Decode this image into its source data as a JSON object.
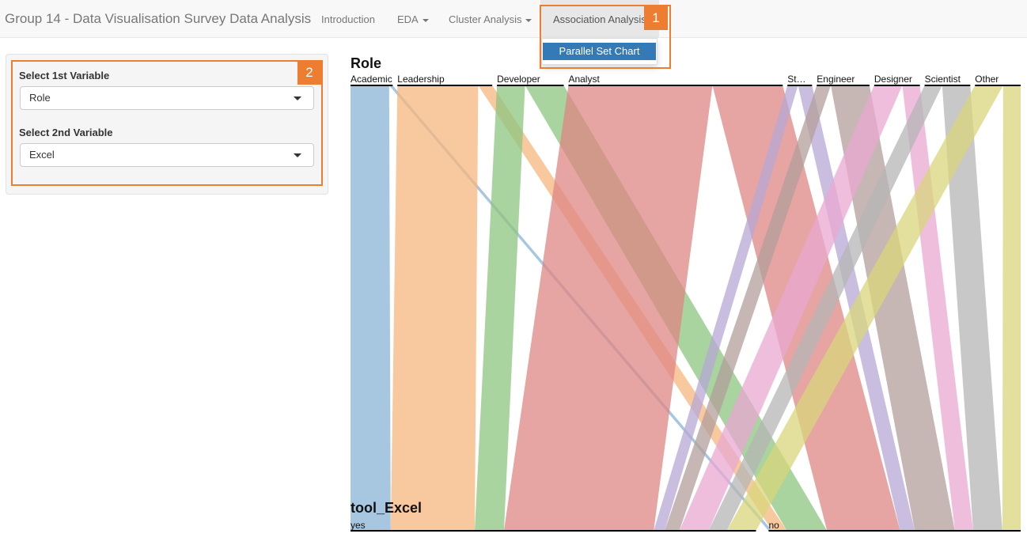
{
  "navbar": {
    "brand": "Group 14 - Data Visualisation Survey Data Analysis",
    "items": [
      {
        "label": "Introduction",
        "dropdown": false
      },
      {
        "label": "EDA",
        "dropdown": true
      },
      {
        "label": "Cluster Analysis",
        "dropdown": true
      },
      {
        "label": "Association Analysis",
        "dropdown": true,
        "active": true
      }
    ],
    "dropdown_menu": [
      {
        "label": "Parallel Set Chart",
        "selected": true
      }
    ]
  },
  "annotations": [
    {
      "number": "1",
      "color": "#ed7d31"
    },
    {
      "number": "2",
      "color": "#ed7d31"
    }
  ],
  "sidebar": {
    "var1": {
      "label": "Select 1st Variable",
      "value": "Role"
    },
    "var2": {
      "label": "Select 2nd Variable",
      "value": "Excel"
    }
  },
  "chart_data": {
    "type": "parallel-sets",
    "dimensions": [
      {
        "name": "Role",
        "categories": [
          "Academic",
          "Leadership",
          "Developer",
          "Analyst",
          "St…",
          "Engineer",
          "Designer",
          "Scientist",
          "Other"
        ]
      },
      {
        "name": "tool_Excel",
        "categories": [
          "yes",
          "no"
        ]
      }
    ],
    "role_counts": {
      "Academic": 12,
      "Leadership": 27,
      "Developer": 19,
      "Analyst": 61,
      "St…": 7,
      "Engineer": 15,
      "Designer": 13,
      "Scientist": 13,
      "Other": 13
    },
    "flows": [
      {
        "from": "Academic",
        "to": "yes",
        "value": 11,
        "color": "#8ab4d5"
      },
      {
        "from": "Academic",
        "to": "no",
        "value": 1,
        "color": "#8ab4d5"
      },
      {
        "from": "Leadership",
        "to": "yes",
        "value": 23,
        "color": "#f6b77e"
      },
      {
        "from": "Leadership",
        "to": "no",
        "value": 4,
        "color": "#f6b77e"
      },
      {
        "from": "Developer",
        "to": "yes",
        "value": 8,
        "color": "#8cc47f"
      },
      {
        "from": "Developer",
        "to": "no",
        "value": 11,
        "color": "#8cc47f"
      },
      {
        "from": "Analyst",
        "to": "yes",
        "value": 41,
        "color": "#dd8583"
      },
      {
        "from": "Analyst",
        "to": "no",
        "value": 20,
        "color": "#dd8583"
      },
      {
        "from": "St…",
        "to": "yes",
        "value": 3,
        "color": "#b7a8d6"
      },
      {
        "from": "St…",
        "to": "no",
        "value": 4,
        "color": "#b7a8d6"
      },
      {
        "from": "Engineer",
        "to": "yes",
        "value": 4,
        "color": "#b39f9b"
      },
      {
        "from": "Engineer",
        "to": "no",
        "value": 11,
        "color": "#b39f9b"
      },
      {
        "from": "Designer",
        "to": "yes",
        "value": 8,
        "color": "#eaa8d2"
      },
      {
        "from": "Designer",
        "to": "no",
        "value": 5,
        "color": "#eaa8d2"
      },
      {
        "from": "Scientist",
        "to": "yes",
        "value": 5,
        "color": "#b6b6b6"
      },
      {
        "from": "Scientist",
        "to": "no",
        "value": 8,
        "color": "#b6b6b6"
      },
      {
        "from": "Other",
        "to": "yes",
        "value": 8,
        "color": "#d8d67b"
      },
      {
        "from": "Other",
        "to": "no",
        "value": 5,
        "color": "#d8d67b"
      }
    ]
  }
}
